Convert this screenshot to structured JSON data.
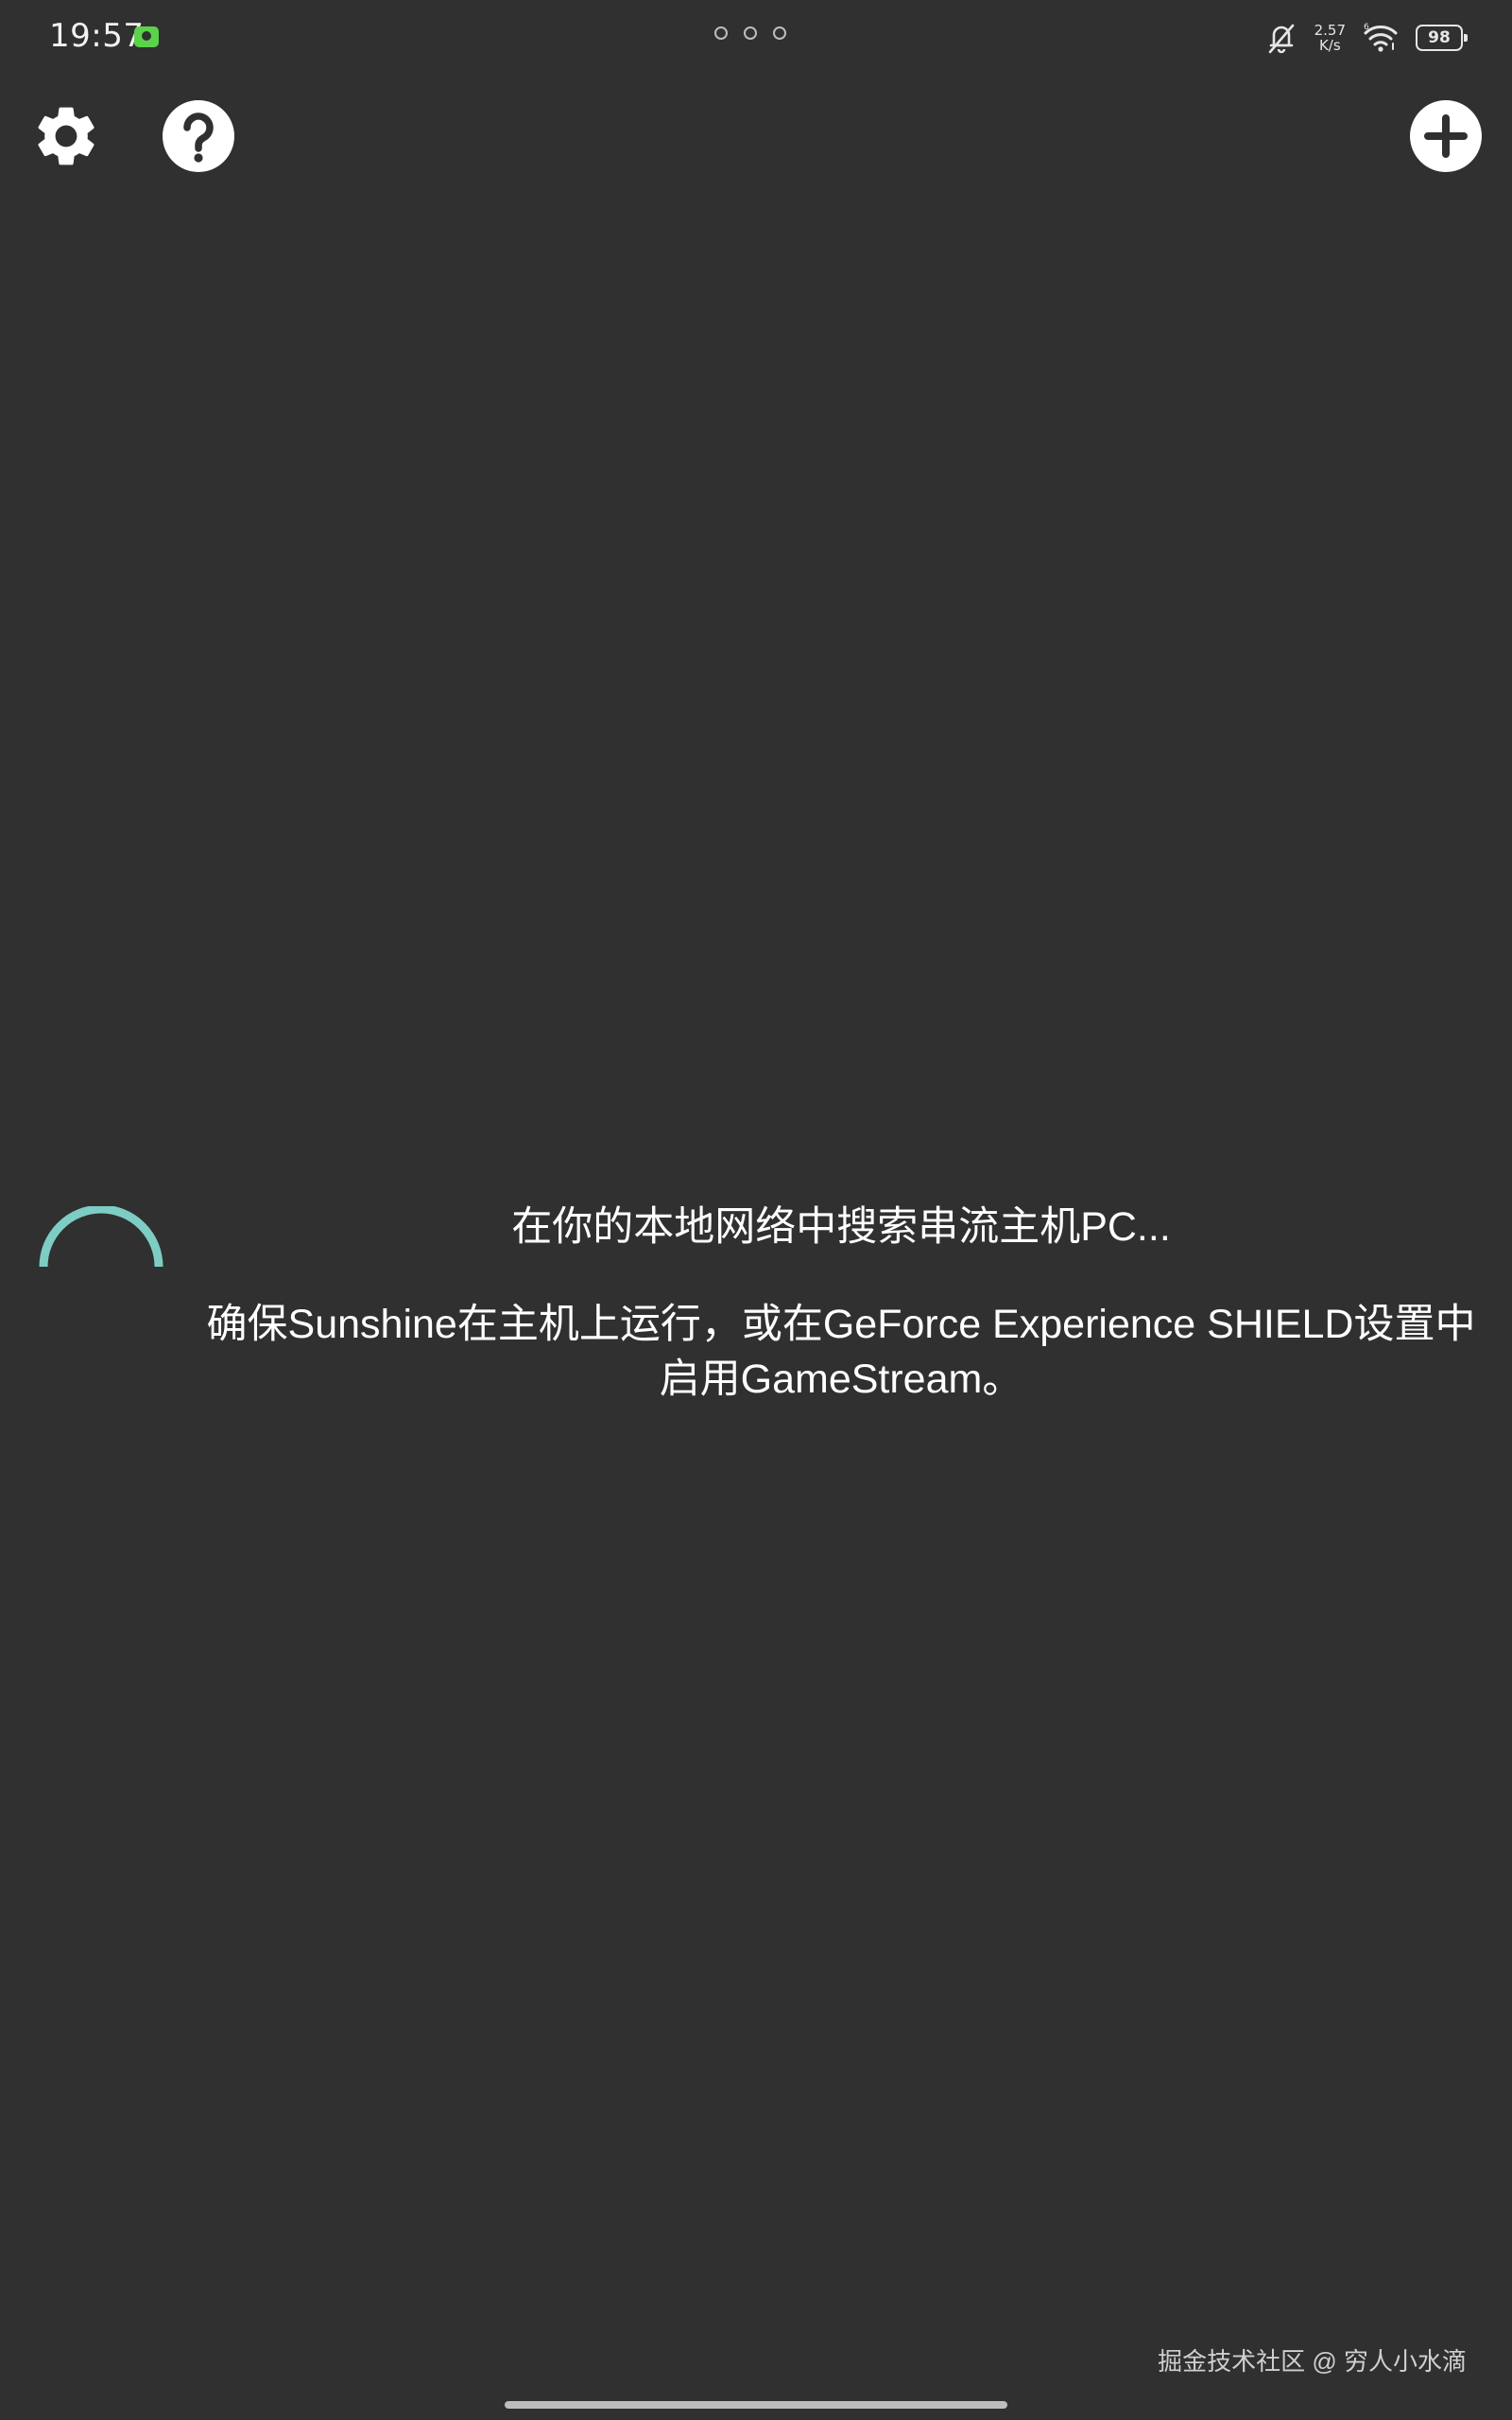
{
  "status_bar": {
    "time": "19:57",
    "net_speed_value": "2.57",
    "net_speed_unit": "K/s",
    "battery_level": "98",
    "icons": [
      "app-notification-icon",
      "page-dots-icon",
      "silent-bell-icon",
      "wifi-icon",
      "battery-icon"
    ]
  },
  "toolbar": {
    "settings_icon": "gear-icon",
    "help_icon": "help-circle-icon",
    "add_icon": "add-circle-icon"
  },
  "discovery": {
    "title": "在你的本地网络中搜索串流主机PC...",
    "hint": "确保Sunshine在主机上运行，或在GeForce Experience SHIELD设置中启用GameStream。",
    "spinner_color": "#7ecdc4"
  },
  "footer": {
    "watermark": "掘金技术社区 @ 穷人小水滴"
  },
  "colors": {
    "background": "#303030",
    "accent": "#7ecdc4",
    "text": "#ffffff"
  }
}
